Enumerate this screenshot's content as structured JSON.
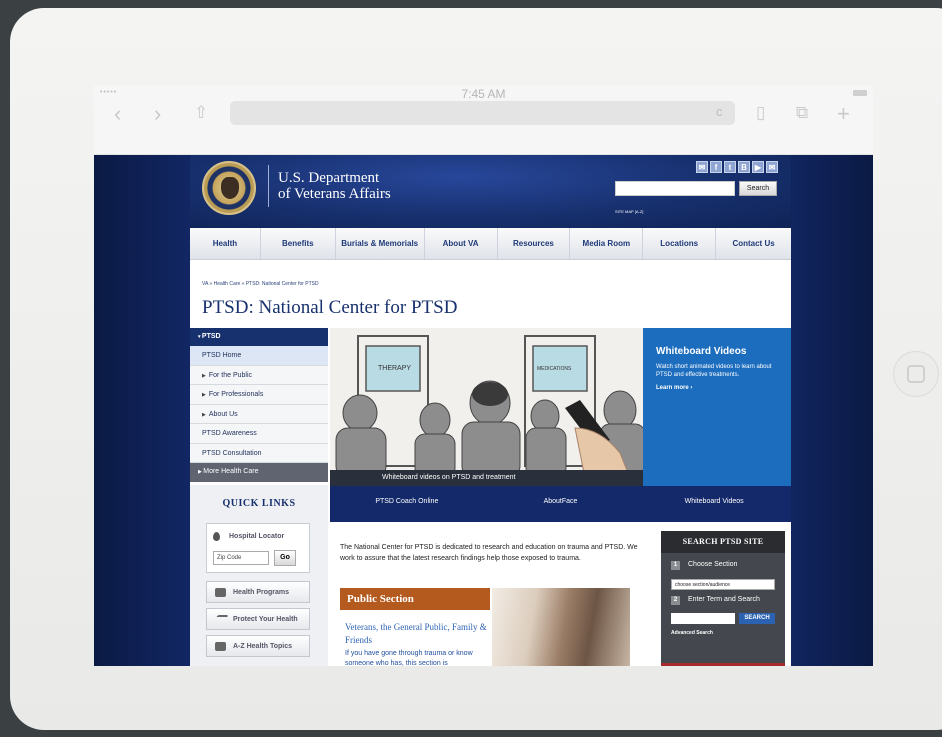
{
  "status_bar": {
    "time": "7:45 AM",
    "signal": "•••••"
  },
  "browser": {
    "back": "‹",
    "forward": "›",
    "share": "⇧",
    "reload": "c",
    "reader": "▯",
    "tabs": "⧉",
    "new_tab": "+"
  },
  "header": {
    "brand_line1": "U.S. Department",
    "brand_line2": "of Veterans Affairs",
    "social": [
      "✉",
      "f",
      "t",
      "B",
      "▶",
      "✉"
    ],
    "search_button": "Search",
    "site_map": "SITE MAP [A-Z]"
  },
  "main_nav": [
    "Health",
    "Benefits",
    "Burials & Memorials",
    "About VA",
    "Resources",
    "Media Room",
    "Locations",
    "Contact Us"
  ],
  "breadcrumb": "VA » Health Care » PTSD: National Center for PTSD",
  "page_title": "PTSD: National Center for PTSD",
  "left_nav": {
    "heading": "PTSD",
    "items": [
      "PTSD Home",
      "For the Public",
      "For Professionals",
      "About Us",
      "PTSD Awareness",
      "PTSD Consultation"
    ],
    "more": "More Health Care"
  },
  "quick_links": {
    "title": "QUICK LINKS",
    "hospital_locator": "Hospital Locator",
    "zip_placeholder": "Zip Code",
    "go": "Go",
    "buttons": [
      "Health Programs",
      "Protect Your Health",
      "A-Z Health Topics"
    ]
  },
  "hero": {
    "caption": "Whiteboard videos on PTSD and treatment",
    "door_left": "THERAPY",
    "door_right": "MEDICATIONS"
  },
  "whiteboard_panel": {
    "title": "Whiteboard Videos",
    "description": "Watch short animated videos to learn about PTSD and effective treatments.",
    "more": "Learn more ›"
  },
  "sub_nav": [
    "PTSD Coach Online",
    "AboutFace",
    "Whiteboard Videos"
  ],
  "intro": "The National Center for PTSD is dedicated to research and education on trauma and PTSD. We work to assure that the latest research findings help those exposed to trauma.",
  "public_section": {
    "heading": "Public Section",
    "link": "Veterans, the General Public, Family & Friends",
    "description": "If you have gone through trauma or know someone who has, this section is"
  },
  "search_site": {
    "title": "SEARCH PTSD SITE",
    "step1": "Choose Section",
    "select_value": "choose section/audience",
    "step2": "Enter Term and Search",
    "button": "SEARCH",
    "advanced": "Advanced Search"
  },
  "colors": {
    "va_navy": "#13296a",
    "va_blue": "#1d6dbe",
    "public_orange": "#b45a1e",
    "search_panel": "#44484e"
  }
}
